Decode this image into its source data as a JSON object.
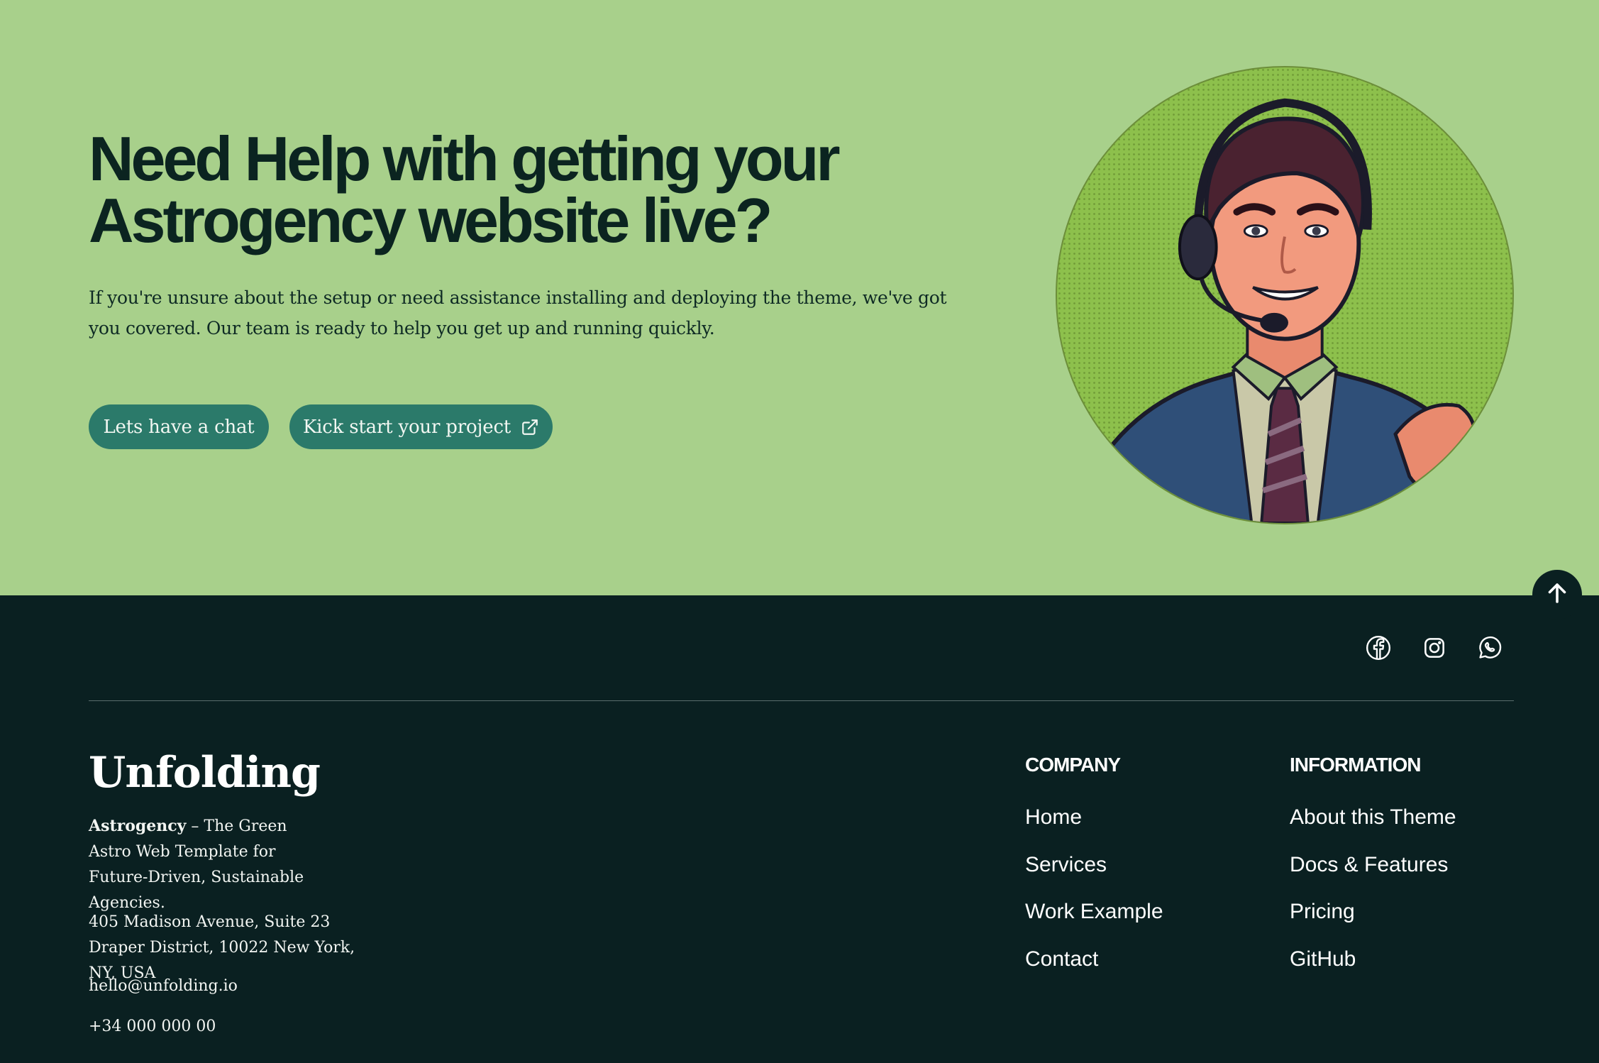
{
  "cta": {
    "title": "Need Help with getting your Astrogency website live?",
    "text": "If you're unsure about the setup or need assistance installing and deploying the theme, we've got you covered. Our team is ready to help you get up and running quickly.",
    "chat_button": "Lets have a chat",
    "kickstart_button": "Kick start your project",
    "kickstart_icon": "external-link-icon",
    "image": "support-agent-portrait"
  },
  "scroll_top": {
    "icon": "arrow-up-icon"
  },
  "footer": {
    "social": [
      {
        "icon": "facebook-icon"
      },
      {
        "icon": "instagram-icon"
      },
      {
        "icon": "whatsapp-icon"
      }
    ],
    "logo": "Unfolding",
    "brand_name": "Astrogency",
    "brand_tagline": " – The Green Astro Web Template for Future-Driven, Sustainable Agencies.",
    "address": "405 Madison Avenue, Suite 23 Draper District, 10022 New York, NY, USA",
    "email": "hello@unfolding.io",
    "phone": "+34 000 000 00",
    "company": {
      "heading": "COMPANY",
      "links": [
        "Home",
        "Services",
        "Work Example",
        "Contact"
      ]
    },
    "information": {
      "heading": "INFORMATION",
      "links": [
        "About this Theme",
        "Docs & Features",
        "Pricing",
        "GitHub"
      ]
    }
  },
  "colors": {
    "cta_background": "#a8d08b",
    "button": "#2b7a6a",
    "footer_background": "#0a2021",
    "heading_text": "#0b2420"
  }
}
